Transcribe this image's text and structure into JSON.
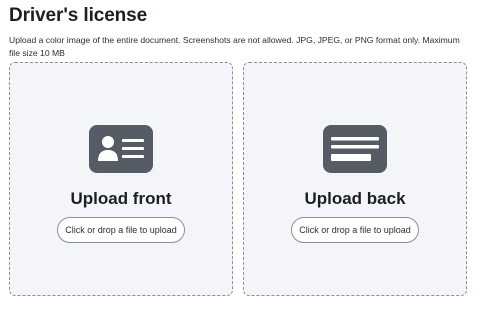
{
  "page": {
    "title": "Driver's license",
    "description": "Upload a color image of the entire document. Screenshots are not allowed. JPG, JPEG, or PNG format only. Maximum file size 10 MB"
  },
  "upload_zones": [
    {
      "title": "Upload front",
      "button_label": "Click or drop a file to upload",
      "icon": "id-card-front-icon"
    },
    {
      "title": "Upload back",
      "button_label": "Click or drop a file to upload",
      "icon": "id-card-back-icon"
    }
  ],
  "colors": {
    "zone_background": "#f4f5f9",
    "zone_border": "#8b8f99",
    "icon_fill": "#565c66",
    "text": "#1c1f24"
  }
}
